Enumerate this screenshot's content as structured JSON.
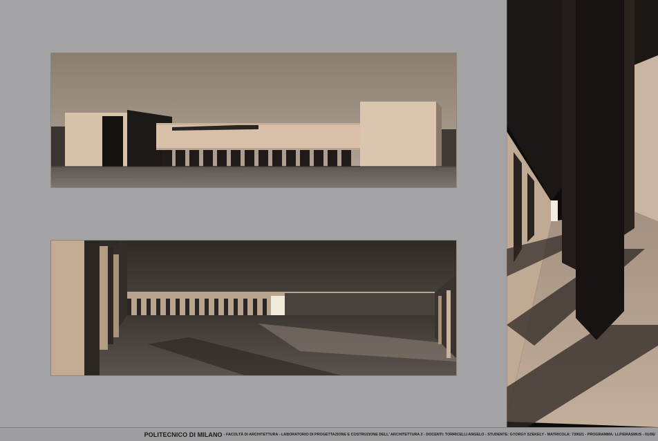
{
  "caption": {
    "institution": "POLITECNICO DI MILANO",
    "details": " - FACOLTÀ DI ARCHITETTURA - LABORATORIO DI PROGETTAZIONE E COSTRUZIONE DELL' ARCHITETTURA 2 - DOCENTI: TORRICELLI ANGELO - STUDENTE: GYORGY SZEKELY - MATRICOLA: 739021 - PROGRAMMA: LLP/ERASMUS - 01/06/"
  },
  "colors": {
    "board_background": "#a3a3a5",
    "sky": "#7d7266",
    "facade": "#d9c3ac",
    "shadow": "#1a1614",
    "pavement": "#6f6660"
  }
}
